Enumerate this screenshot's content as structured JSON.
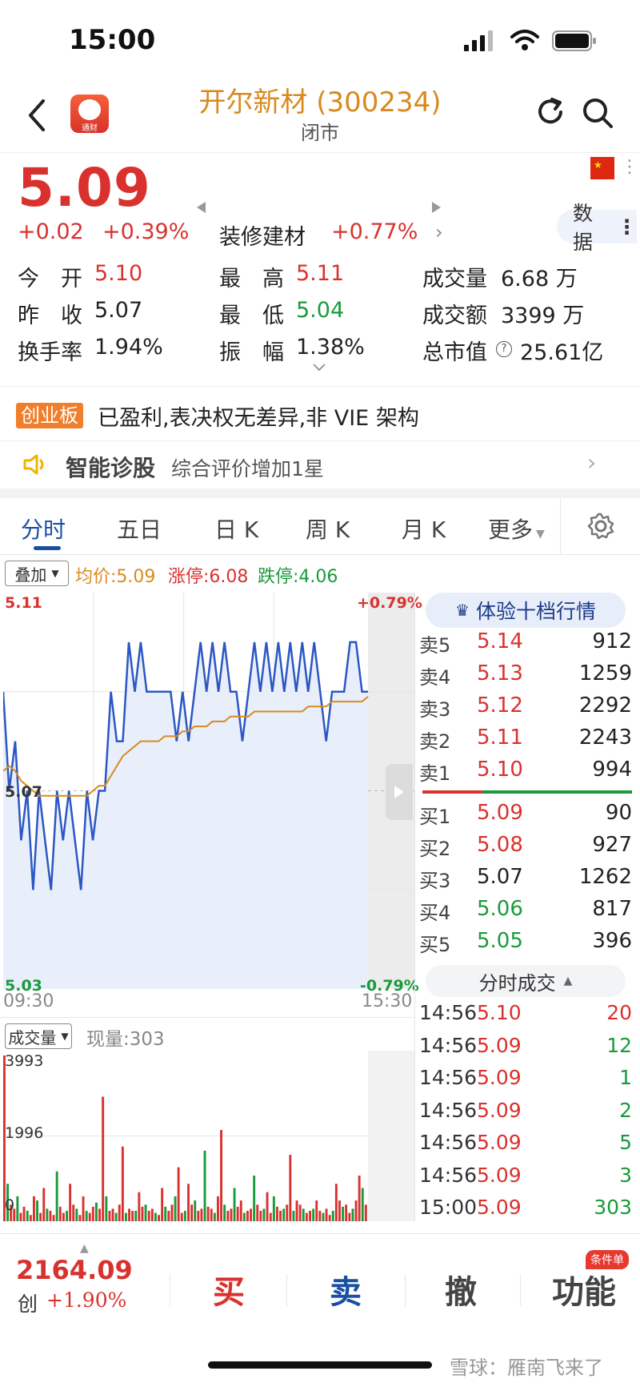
{
  "status_bar": {
    "time": "15:00"
  },
  "header": {
    "title": "开尔新材 (300234)",
    "subtitle": "闭市",
    "app_icon_label": "通财"
  },
  "quote": {
    "price": "5.09",
    "change": "+0.02",
    "change_pct": "+0.39%",
    "sector": "装修建材",
    "sector_pct": "+0.77%",
    "data_button": "数据",
    "rows": [
      [
        {
          "label": "今　开",
          "value": "5.10",
          "color": "red"
        },
        {
          "label": "最　高",
          "value": "5.11",
          "color": "red"
        },
        {
          "label": "成交量",
          "value": "6.68 万",
          "color": "black"
        }
      ],
      [
        {
          "label": "昨　收",
          "value": "5.07",
          "color": "black"
        },
        {
          "label": "最　低",
          "value": "5.04",
          "color": "green"
        },
        {
          "label": "成交额",
          "value": "3399 万",
          "color": "black"
        }
      ],
      [
        {
          "label": "换手率",
          "value": "1.94%",
          "color": "black"
        },
        {
          "label": "振　幅",
          "value": "1.38%",
          "color": "black"
        },
        {
          "label": "总市值",
          "value": "25.61亿",
          "color": "black"
        }
      ]
    ]
  },
  "tags": {
    "board_badge": "创业板",
    "board_text": "已盈利,表决权无差异,非 VIE 架构"
  },
  "diagnosis": {
    "title": "智能诊股",
    "text": "综合评价增加1星"
  },
  "tabs": [
    "分时",
    "五日",
    "日 K",
    "周 K",
    "月 K",
    "更多"
  ],
  "chart_toolbar": {
    "overlay": "叠加",
    "avg": "均价:5.09",
    "limit_up": "涨停:6.08",
    "limit_down": "跌停:4.06"
  },
  "chart_labels": {
    "y_top": "5.11",
    "y_mid": "5.07",
    "y_bottom": "5.03",
    "pct_top": "+0.79%",
    "pct_bottom": "-0.79%",
    "x_start": "09:30",
    "x_end": "15:30"
  },
  "chart_data": {
    "type": "line",
    "ylim": [
      5.03,
      5.11
    ],
    "x": [
      "09:30",
      "15:30"
    ],
    "series": [
      {
        "name": "price",
        "color": "#2b56c4",
        "values": [
          5.09,
          5.07,
          5.08,
          5.06,
          5.07,
          5.05,
          5.07,
          5.06,
          5.05,
          5.07,
          5.06,
          5.07,
          5.06,
          5.05,
          5.07,
          5.06,
          5.07,
          5.07,
          5.09,
          5.08,
          5.08,
          5.1,
          5.09,
          5.1,
          5.09,
          5.09,
          5.09,
          5.09,
          5.09,
          5.08,
          5.09,
          5.08,
          5.09,
          5.1,
          5.09,
          5.1,
          5.09,
          5.1,
          5.09,
          5.09,
          5.08,
          5.09,
          5.1,
          5.09,
          5.1,
          5.09,
          5.1,
          5.09,
          5.1,
          5.09,
          5.1,
          5.09,
          5.1,
          5.09,
          5.08,
          5.09,
          5.09,
          5.09,
          5.1,
          5.1,
          5.09,
          5.09
        ]
      },
      {
        "name": "avg",
        "color": "#d98a1e",
        "values": [
          5.074,
          5.075,
          5.074,
          5.072,
          5.071,
          5.07,
          5.069,
          5.069,
          5.069,
          5.069,
          5.069,
          5.069,
          5.069,
          5.069,
          5.069,
          5.07,
          5.071,
          5.071,
          5.073,
          5.075,
          5.077,
          5.078,
          5.079,
          5.08,
          5.08,
          5.08,
          5.08,
          5.081,
          5.081,
          5.081,
          5.082,
          5.082,
          5.083,
          5.083,
          5.083,
          5.084,
          5.084,
          5.084,
          5.085,
          5.085,
          5.085,
          5.085,
          5.086,
          5.086,
          5.086,
          5.086,
          5.086,
          5.086,
          5.086,
          5.086,
          5.086,
          5.087,
          5.087,
          5.087,
          5.087,
          5.088,
          5.088,
          5.088,
          5.088,
          5.088,
          5.088,
          5.089
        ]
      }
    ]
  },
  "order_book": {
    "l2_button": "体验十档行情",
    "asks": [
      {
        "label": "卖5",
        "price": "5.14",
        "qty": "912",
        "color": "red"
      },
      {
        "label": "卖4",
        "price": "5.13",
        "qty": "1259",
        "color": "red"
      },
      {
        "label": "卖3",
        "price": "5.12",
        "qty": "2292",
        "color": "red"
      },
      {
        "label": "卖2",
        "price": "5.11",
        "qty": "2243",
        "color": "red"
      },
      {
        "label": "卖1",
        "price": "5.10",
        "qty": "994",
        "color": "red"
      }
    ],
    "bids": [
      {
        "label": "买1",
        "price": "5.09",
        "qty": "90",
        "color": "red"
      },
      {
        "label": "买2",
        "price": "5.08",
        "qty": "927",
        "color": "red"
      },
      {
        "label": "买3",
        "price": "5.07",
        "qty": "1262",
        "color": "black"
      },
      {
        "label": "买4",
        "price": "5.06",
        "qty": "817",
        "color": "green"
      },
      {
        "label": "买5",
        "price": "5.05",
        "qty": "396",
        "color": "green"
      }
    ]
  },
  "ticks": {
    "button": "分时成交",
    "rows": [
      {
        "time": "14:56",
        "price": "5.10",
        "qty": "20",
        "color": "red"
      },
      {
        "time": "14:56",
        "price": "5.09",
        "qty": "12",
        "color": "green"
      },
      {
        "time": "14:56",
        "price": "5.09",
        "qty": "1",
        "color": "green"
      },
      {
        "time": "14:56",
        "price": "5.09",
        "qty": "2",
        "color": "green"
      },
      {
        "time": "14:56",
        "price": "5.09",
        "qty": "5",
        "color": "green"
      },
      {
        "time": "14:56",
        "price": "5.09",
        "qty": "3",
        "color": "green"
      },
      {
        "time": "15:00",
        "price": "5.09",
        "qty": "303",
        "color": "green"
      }
    ]
  },
  "volume": {
    "button": "成交量",
    "current": "现量:303",
    "y_top": "3993",
    "y_mid": "1996",
    "y_bottom": "0",
    "values": [
      3993,
      900,
      400,
      300,
      600,
      200,
      350,
      250,
      150,
      600,
      500,
      200,
      800,
      300,
      250,
      150,
      1200,
      350,
      200,
      250,
      900,
      400,
      300,
      150,
      600,
      250,
      200,
      350,
      450,
      300,
      3000,
      600,
      250,
      300,
      200,
      400,
      1800,
      200,
      300,
      250,
      250,
      700,
      350,
      400,
      250,
      300,
      200,
      150,
      800,
      350,
      250,
      400,
      600,
      1300,
      200,
      250,
      900,
      400,
      500,
      250,
      300,
      1700,
      350,
      300,
      200,
      600,
      2200,
      400,
      250,
      300,
      800,
      350,
      500,
      200,
      250,
      300,
      1100,
      400,
      250,
      300,
      700,
      200,
      600,
      350,
      250,
      300,
      400,
      1600,
      250,
      500,
      400,
      300,
      200,
      250,
      300,
      500,
      250,
      200,
      300,
      150,
      250,
      900,
      500,
      350,
      400,
      200,
      300,
      500,
      1100,
      800,
      400
    ]
  },
  "bottom_bar": {
    "index_value": "2164.09",
    "index_label": "创",
    "index_pct": "+1.90%",
    "buy": "买",
    "sell": "卖",
    "cancel": "撤",
    "function": "功能",
    "function_badge": "条件单"
  },
  "watermark": "雪球：雁南飞来了"
}
